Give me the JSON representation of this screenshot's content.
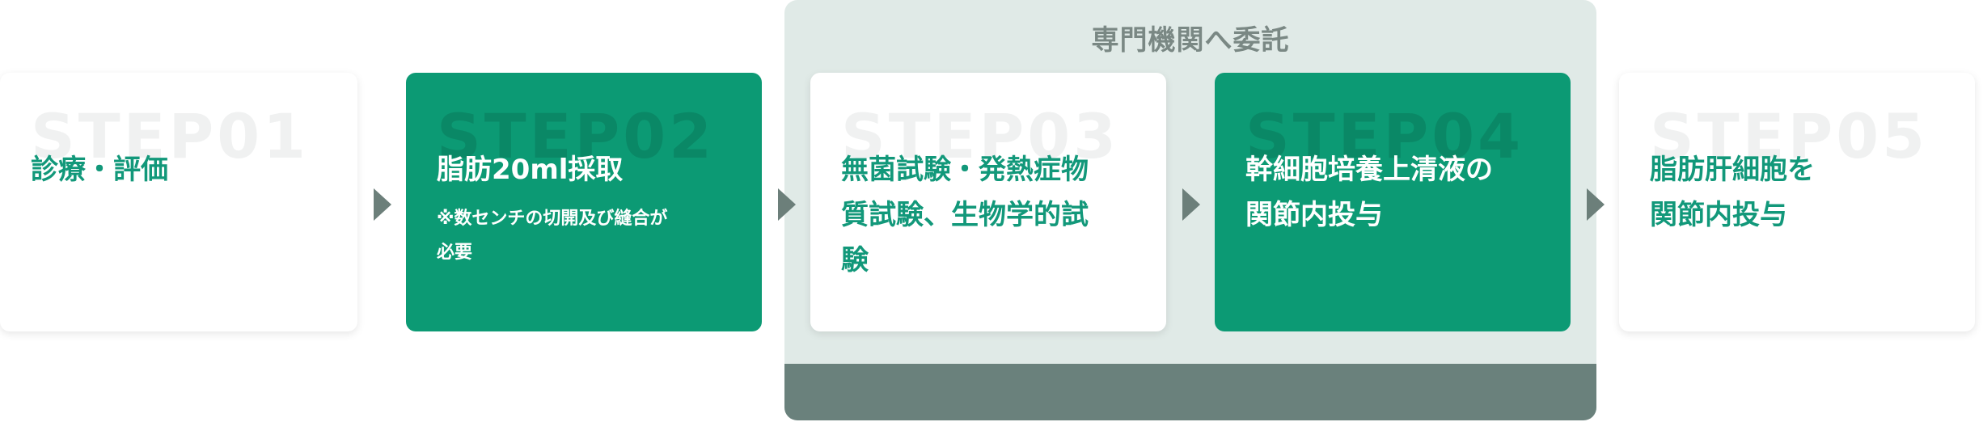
{
  "group": {
    "title": "専門機関へ委託"
  },
  "steps": [
    {
      "label": "STEP01",
      "title": "診療・評価",
      "note": ""
    },
    {
      "label": "STEP02",
      "title": "脂肪20ml採取",
      "note": "※数センチの切開及び縫合が\n必要"
    },
    {
      "label": "STEP03",
      "title": "無菌試験・発熱症物\n質試験、生物学的試\n験",
      "note": ""
    },
    {
      "label": "STEP04",
      "title": "幹細胞培養上清液の\n関節内投与",
      "note": ""
    },
    {
      "label": "STEP05",
      "title": "脂肪肝細胞を\n関節内投与",
      "note": ""
    }
  ],
  "colors": {
    "green": "#0c9a74",
    "group_bg": "#e0eae7",
    "group_band": "#6a817c",
    "arrow": "#6c7f7a"
  },
  "icons": {
    "arrow": "triangle-right"
  }
}
